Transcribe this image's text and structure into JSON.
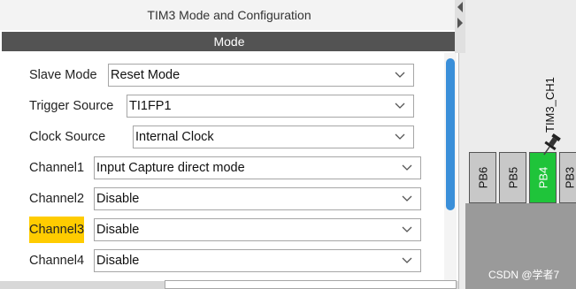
{
  "panel": {
    "title": "TIM3 Mode and Configuration",
    "section_label": "Mode"
  },
  "form": {
    "rows": [
      {
        "label": "Slave Mode",
        "value": "Reset Mode",
        "highlighted": false
      },
      {
        "label": "Trigger Source",
        "value": "TI1FP1",
        "highlighted": false
      },
      {
        "label": "Clock Source",
        "value": "Internal Clock",
        "highlighted": false
      },
      {
        "label": "Channel1",
        "value": "Input Capture direct mode",
        "highlighted": false
      },
      {
        "label": "Channel2",
        "value": "Disable",
        "highlighted": false
      },
      {
        "label": "Channel3",
        "value": "Disable",
        "highlighted": true
      },
      {
        "label": "Channel4",
        "value": "Disable",
        "highlighted": false
      }
    ]
  },
  "chip": {
    "signal_label": "TIM3_CH1",
    "pins": [
      {
        "label": "PB6",
        "active": false
      },
      {
        "label": "PB5",
        "active": false
      },
      {
        "label": "PB4",
        "active": true
      },
      {
        "label": "PB3",
        "active": false
      }
    ]
  },
  "watermark": "CSDN @学者7",
  "colors": {
    "mode_bar": "#535353",
    "highlight": "#ffcc00",
    "active_pin": "#1fc43a",
    "scrollbar": "#3a8fd9"
  }
}
